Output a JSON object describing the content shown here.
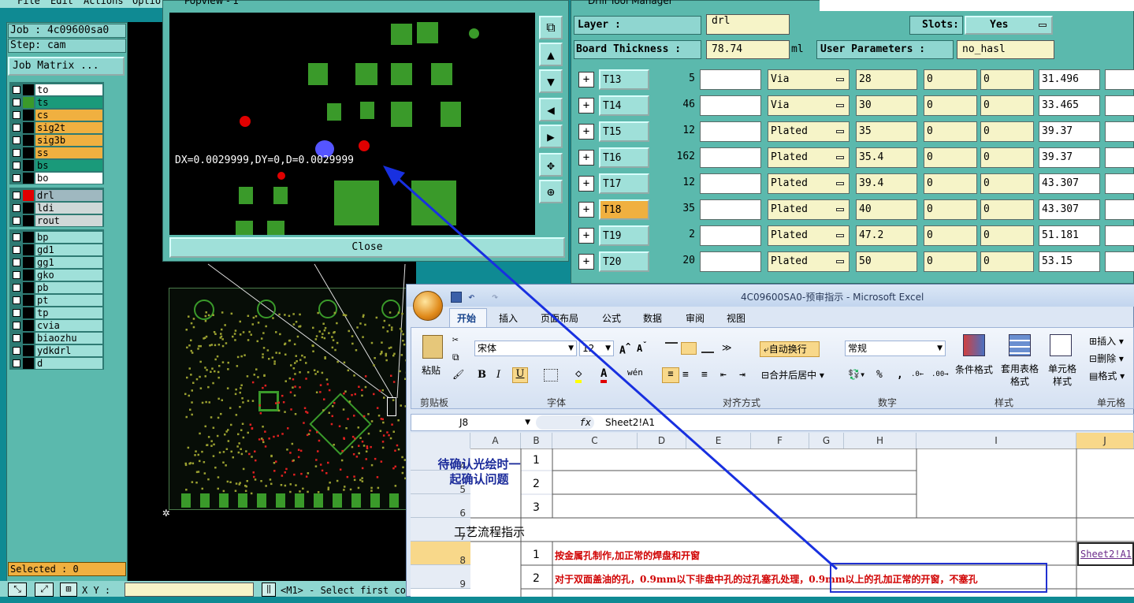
{
  "menu": {
    "file": "File",
    "edit": "Edit",
    "actions": "Actions",
    "options": "Optio"
  },
  "left": {
    "job": "Job : 4c09600sa0",
    "step": "Step: cam",
    "job_matrix": "Job Matrix ...",
    "selected": "Selected : 0",
    "xy": "X Y :"
  },
  "layers_a": [
    {
      "n": "to",
      "c": "#ffffff"
    },
    {
      "n": "ts",
      "c": "#1a9a7a"
    },
    {
      "n": "cs",
      "c": "#f0b040"
    },
    {
      "n": "sig2t",
      "c": "#f0b040"
    },
    {
      "n": "sig3b",
      "c": "#f0b040"
    },
    {
      "n": "ss",
      "c": "#f0b040"
    },
    {
      "n": "bs",
      "c": "#1a9a7a"
    },
    {
      "n": "bo",
      "c": "#ffffff"
    }
  ],
  "layers_b": [
    {
      "n": "drl",
      "c": "#9fb8c0"
    },
    {
      "n": "ldi",
      "c": "#cfd8d8"
    },
    {
      "n": "rout",
      "c": "#cfd8d8"
    }
  ],
  "layers_c": [
    "bp",
    "gd1",
    "gg1",
    "gko",
    "pb",
    "pt",
    "tp",
    "cvia",
    "biaozhu",
    "ydkdrl",
    "d"
  ],
  "popview": {
    "title": "Popview - 1",
    "measure": "DX=0.0029999,DY=0,D=0.0029999",
    "close": "Close"
  },
  "drill": {
    "title": "Drill Tool Manager",
    "layer_label": "Layer :",
    "layer_value": "drl",
    "slots_label": "Slots:",
    "slots_value": "Yes",
    "thickness_label": "Board Thickness :",
    "thickness_value": "78.74",
    "unit": "ml",
    "user_params_label": "User Parameters :",
    "user_params_value": "no_hasl",
    "rows": [
      {
        "tool": "T13",
        "count": "5",
        "type": "Via",
        "size": "28",
        "a": "0",
        "b": "0",
        "finish": "31.496"
      },
      {
        "tool": "T14",
        "count": "46",
        "type": "Via",
        "size": "30",
        "a": "0",
        "b": "0",
        "finish": "33.465"
      },
      {
        "tool": "T15",
        "count": "12",
        "type": "Plated",
        "size": "35",
        "a": "0",
        "b": "0",
        "finish": "39.37"
      },
      {
        "tool": "T16",
        "count": "162",
        "type": "Plated",
        "size": "35.4",
        "a": "0",
        "b": "0",
        "finish": "39.37"
      },
      {
        "tool": "T17",
        "count": "12",
        "type": "Plated",
        "size": "39.4",
        "a": "0",
        "b": "0",
        "finish": "43.307"
      },
      {
        "tool": "T18",
        "count": "35",
        "type": "Plated",
        "size": "40",
        "a": "0",
        "b": "0",
        "finish": "43.307"
      },
      {
        "tool": "T19",
        "count": "2",
        "type": "Plated",
        "size": "47.2",
        "a": "0",
        "b": "0",
        "finish": "51.181"
      },
      {
        "tool": "T20",
        "count": "20",
        "type": "Plated",
        "size": "50",
        "a": "0",
        "b": "0",
        "finish": "53.15"
      }
    ]
  },
  "excel": {
    "title": "4C09600SA0-预审指示 - Microsoft Excel",
    "tabs": [
      "开始",
      "插入",
      "页面布局",
      "公式",
      "数据",
      "审阅",
      "视图"
    ],
    "font_name": "宋体",
    "font_size": "12",
    "wrap": "自动换行",
    "merge": "合并后居中",
    "numfmt": "常规",
    "paste": "粘贴",
    "cond": "条件格式",
    "table": "套用表格格式",
    "cellstyle": "单元格样式",
    "insert": "插入",
    "delete": "删除",
    "format": "格式",
    "groups": [
      "剪贴板",
      "字体",
      "对齐方式",
      "数字",
      "样式",
      "单元格"
    ],
    "namebox": "J8",
    "formula": "Sheet2!A1",
    "cols": [
      "A",
      "B",
      "C",
      "D",
      "E",
      "F",
      "G",
      "H",
      "I",
      "J"
    ],
    "rows": [
      "4",
      "5",
      "6",
      "7",
      "8",
      "9"
    ],
    "merged_a": "待确认光绘时一起确认问题",
    "nums": [
      "1",
      "2",
      "3"
    ],
    "section": "工艺流程指示",
    "line1": "按金属孔制作,加正常的焊盘和开窗",
    "line2": "对于双面盖油的孔，0.9mm以下非盘中孔的过孔塞孔处理，0.9mm以上的孔加正常的开窗，不塞孔",
    "link": "Sheet2!A1",
    "n1": "1",
    "n2": "2"
  },
  "status": "<M1> - Select first co"
}
